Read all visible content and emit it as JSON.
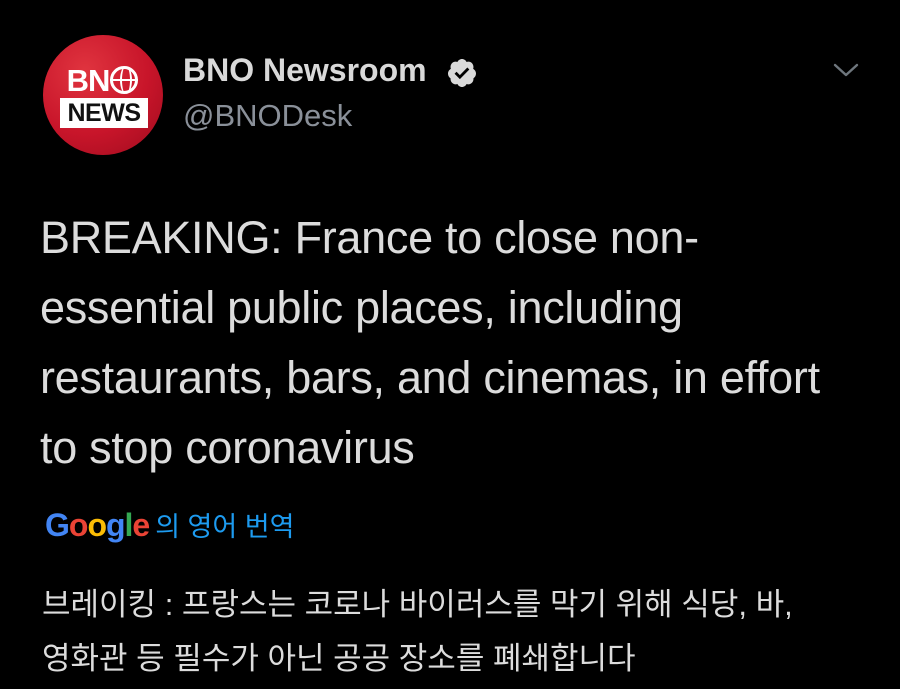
{
  "account": {
    "display_name": "BNO Newsroom",
    "handle": "@BNODesk",
    "avatar_line1_a": "BN",
    "avatar_line2": "NEWS",
    "verified": true
  },
  "tweet": {
    "text": "BREAKING: France to close non-essential public places, including restaurants, bars, and cinemas, in effort to stop coronavirus",
    "text_lines": [
      "BREAKING: France to close non-",
      "essential public places, including",
      "restaurants, bars, and cinemas, in effort",
      "to stop coronavirus"
    ]
  },
  "translation": {
    "provider_letters": [
      "G",
      "o",
      "o",
      "g",
      "l",
      "e"
    ],
    "label": "의 영어 번역",
    "lines": [
      "브레이킹 : 프랑스는 코로나 바이러스를 막기 위해 식당, 바,",
      "영화관 등 필수가 아닌 공공 장소를 폐쇄합니다"
    ]
  },
  "colors": {
    "background": "#000000",
    "link": "#1d9bf0",
    "avatar_red": "#c8152a",
    "muted": "#8a9099"
  },
  "icons": {
    "verified": "verified-badge-icon",
    "menu": "chevron-down-icon"
  }
}
